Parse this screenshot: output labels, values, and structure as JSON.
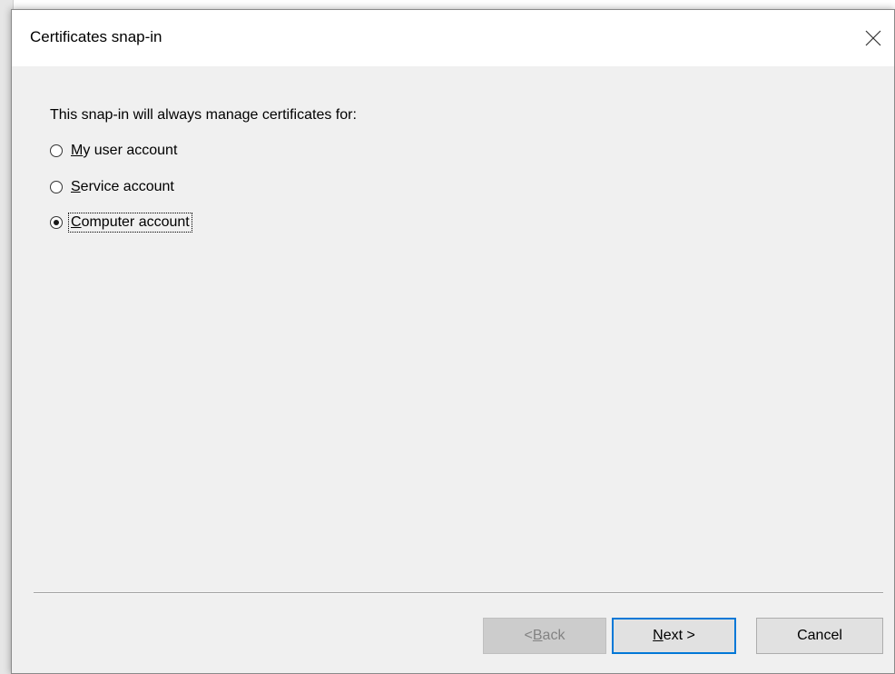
{
  "dialog": {
    "title": "Certificates snap-in",
    "close_icon": "close-icon"
  },
  "content": {
    "prompt": "This snap-in will always manage certificates for:",
    "options": [
      {
        "accesskey": "M",
        "rest": "y user account",
        "selected": false
      },
      {
        "accesskey": "S",
        "rest": "ervice account",
        "selected": false
      },
      {
        "accesskey": "C",
        "rest": "omputer account",
        "selected": true
      }
    ]
  },
  "buttons": {
    "back_prefix": "< ",
    "back_accesskey": "B",
    "back_rest": "ack",
    "next_accesskey": "N",
    "next_rest": "ext >",
    "cancel": "Cancel"
  },
  "colors": {
    "dialog_bg": "#f0f0f0",
    "titlebar_bg": "#ffffff",
    "default_button_border": "#0078d7",
    "disabled_text": "#838383"
  }
}
